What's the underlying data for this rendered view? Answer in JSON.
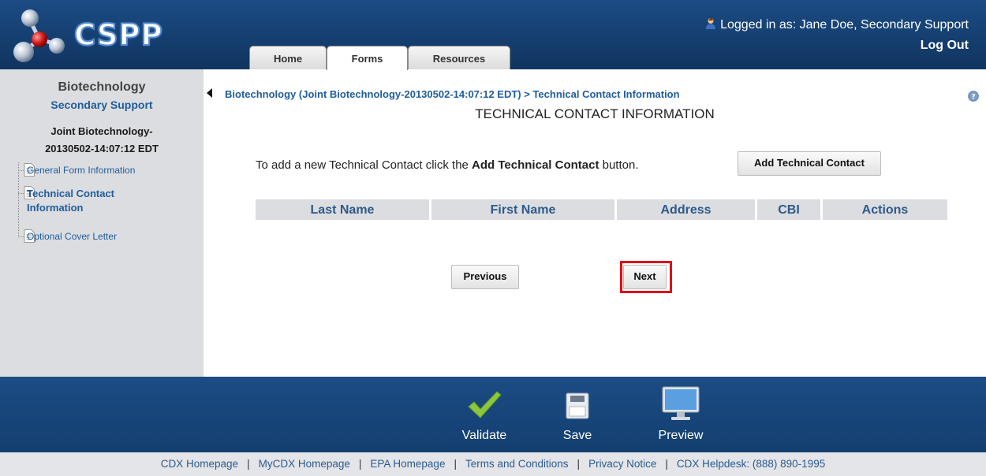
{
  "header": {
    "logo_text": "CSPP",
    "tabs": [
      {
        "label": "Home"
      },
      {
        "label": "Forms"
      },
      {
        "label": "Resources"
      }
    ],
    "login_text": "Logged in as: Jane Doe, Secondary Support",
    "logout_label": "Log Out"
  },
  "sidebar": {
    "title": "Biotechnology",
    "role": "Secondary Support",
    "submission_line1": "Joint Biotechnology-",
    "submission_line2": "20130502-14:07:12 EDT",
    "items": [
      {
        "label": "General Form Information"
      },
      {
        "label_line1": "Technical Contact",
        "label_line2": "Information"
      },
      {
        "label": "Optional Cover Letter"
      }
    ]
  },
  "main": {
    "breadcrumb": "Biotechnology (Joint Biotechnology-20130502-14:07:12 EDT) > Technical Contact Information",
    "page_title": "TECHNICAL CONTACT INFORMATION",
    "instruction_prefix": "To add a new Technical Contact click the ",
    "instruction_bold": "Add Technical Contact",
    "instruction_suffix": " button.",
    "add_button_label": "Add Technical Contact",
    "table_columns": [
      "Last Name",
      "First Name",
      "Address",
      "CBI",
      "Actions"
    ],
    "previous_label": "Previous",
    "next_label": "Next"
  },
  "toolbar": {
    "validate_label": "Validate",
    "save_label": "Save",
    "preview_label": "Preview"
  },
  "footer": {
    "links": [
      "CDX Homepage",
      "MyCDX Homepage",
      "EPA Homepage",
      "Terms and Conditions",
      "Privacy Notice",
      "CDX Helpdesk: (888) 890-1995"
    ]
  },
  "colors": {
    "header_blue": "#153f70",
    "link_blue": "#1f5d9c",
    "highlight_red": "#e00f17",
    "sidebar_gray": "#dcdde0"
  }
}
